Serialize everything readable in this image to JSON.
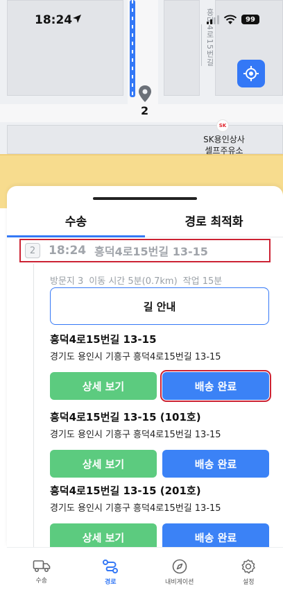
{
  "status_bar": {
    "time": "18:24",
    "battery": "99"
  },
  "map": {
    "street_name": "흥덕4로15번길",
    "pin_label": "2",
    "poi_logo": "SK",
    "poi_name_line1": "SK용인상사",
    "poi_name_line2": "셀프주유소"
  },
  "tabs": [
    {
      "label": "수송",
      "active": true
    },
    {
      "label": "경로 최적화",
      "active": false
    }
  ],
  "stop": {
    "number": "2",
    "time": "18:24",
    "address": "흥덕4로15번길 13-15",
    "meta": {
      "visits": "방문지 3",
      "travel": "이동 시간 5분(0.7km)",
      "work": "작업 15분"
    },
    "guide_label": "길 안내"
  },
  "items": [
    {
      "title": "흥덕4로15번길 13-15",
      "address": "경기도 용인시 기흥구 흥덕4로15번길 13-15",
      "detail_label": "상세 보기",
      "complete_label": "배송 완료"
    },
    {
      "title": "흥덕4로15번길 13-15 (101호)",
      "address": "경기도 용인시 기흥구 흥덕4로15번길 13-15",
      "detail_label": "상세 보기",
      "complete_label": "배송 완료"
    },
    {
      "title": "흥덕4로15번길 13-15 (201호)",
      "address": "경기도 용인시 기흥구 흥덕4로15번길 13-15",
      "detail_label": "상세 보기",
      "complete_label": "배송 완료"
    }
  ],
  "bottom_nav": [
    {
      "label": "수송",
      "icon": "truck-icon",
      "active": false
    },
    {
      "label": "경로",
      "icon": "route-icon",
      "active": true
    },
    {
      "label": "내비게이션",
      "icon": "compass-icon",
      "active": false
    },
    {
      "label": "설정",
      "icon": "gear-icon",
      "active": false
    }
  ],
  "colors": {
    "accent": "#3478f6",
    "complete_button": "#3b82f6",
    "detail_button": "#5ccb7f",
    "highlight_border": "#cc2233"
  }
}
